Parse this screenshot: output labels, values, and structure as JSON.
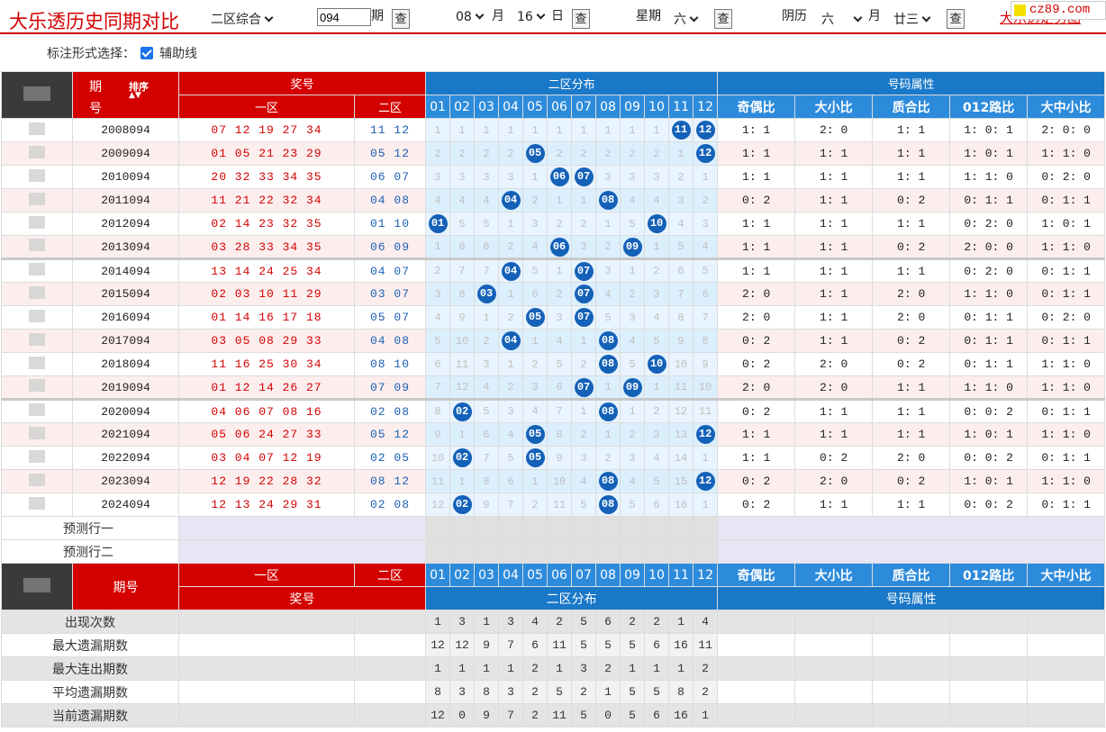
{
  "top": {
    "title": "大乐透历史同期对比",
    "zone_select": "二区综合",
    "issue_value": "094",
    "issue_unit": "期",
    "query": "查",
    "month_value": "08",
    "month_unit": "月",
    "day_value": "16",
    "day_unit": "日",
    "weekday_label": "星期",
    "weekday_value": "六",
    "lunar_label": "阴历",
    "lunar_month": "六",
    "lunar_month_unit": "月",
    "lunar_day": "廿三",
    "link": "大乐透走势图",
    "watermark": "cz89.com"
  },
  "options": {
    "label": "标注形式选择：",
    "checkbox_label": "辅助线",
    "checked": true
  },
  "header": {
    "period_top": "期",
    "period_bottom": "号",
    "sort": "排序",
    "prize": "奖号",
    "zone1": "一区",
    "zone2": "二区",
    "dist": "二区分布",
    "attr": "号码属性",
    "nums": [
      "01",
      "02",
      "03",
      "04",
      "05",
      "06",
      "07",
      "08",
      "09",
      "10",
      "11",
      "12"
    ],
    "attrs": [
      "奇偶比",
      "大小比",
      "质合比",
      "012路比",
      "大中小比"
    ],
    "period_foot": "期号"
  },
  "rows": [
    {
      "issue": "2008094",
      "z1": "07 12 19 27 34",
      "z2": "11 12",
      "hits": [
        11,
        12
      ],
      "miss": [
        1,
        1,
        1,
        1,
        1,
        1,
        1,
        1,
        1,
        1,
        0,
        0
      ],
      "attr": [
        "1:1",
        "2:0",
        "1:1",
        "1:0:1",
        "2:0:0"
      ]
    },
    {
      "issue": "2009094",
      "z1": "01 05 21 23 29",
      "z2": "05 12",
      "hits": [
        5,
        12
      ],
      "miss": [
        2,
        2,
        2,
        2,
        0,
        2,
        2,
        2,
        2,
        2,
        1,
        0
      ],
      "attr": [
        "1:1",
        "1:1",
        "1:1",
        "1:0:1",
        "1:1:0"
      ]
    },
    {
      "issue": "2010094",
      "z1": "20 32 33 34 35",
      "z2": "06 07",
      "hits": [
        6,
        7
      ],
      "miss": [
        3,
        3,
        3,
        3,
        1,
        0,
        0,
        3,
        3,
        3,
        2,
        1
      ],
      "attr": [
        "1:1",
        "1:1",
        "1:1",
        "1:1:0",
        "0:2:0"
      ]
    },
    {
      "issue": "2011094",
      "z1": "11 21 22 32 34",
      "z2": "04 08",
      "hits": [
        4,
        8
      ],
      "miss": [
        4,
        4,
        4,
        0,
        2,
        1,
        1,
        0,
        4,
        4,
        3,
        2
      ],
      "attr": [
        "0:2",
        "1:1",
        "0:2",
        "0:1:1",
        "0:1:1"
      ]
    },
    {
      "issue": "2012094",
      "z1": "02 14 23 32 35",
      "z2": "01 10",
      "hits": [
        1,
        10
      ],
      "miss": [
        0,
        5,
        5,
        1,
        3,
        2,
        2,
        1,
        5,
        0,
        4,
        3
      ],
      "attr": [
        "1:1",
        "1:1",
        "1:1",
        "0:2:0",
        "1:0:1"
      ]
    },
    {
      "issue": "2013094",
      "z1": "03 28 33 34 35",
      "z2": "06 09",
      "hits": [
        6,
        9
      ],
      "miss": [
        1,
        6,
        6,
        2,
        4,
        0,
        3,
        2,
        0,
        1,
        5,
        4
      ],
      "attr": [
        "1:1",
        "1:1",
        "0:2",
        "2:0:0",
        "1:1:0"
      ]
    },
    {
      "issue": "2014094",
      "z1": "13 14 24 25 34",
      "z2": "04 07",
      "hits": [
        4,
        7
      ],
      "miss": [
        2,
        7,
        7,
        0,
        5,
        1,
        0,
        3,
        1,
        2,
        6,
        5
      ],
      "attr": [
        "1:1",
        "1:1",
        "1:1",
        "0:2:0",
        "0:1:1"
      ]
    },
    {
      "issue": "2015094",
      "z1": "02 03 10 11 29",
      "z2": "03 07",
      "hits": [
        3,
        7
      ],
      "miss": [
        3,
        8,
        0,
        1,
        6,
        2,
        0,
        4,
        2,
        3,
        7,
        6
      ],
      "attr": [
        "2:0",
        "1:1",
        "2:0",
        "1:1:0",
        "0:1:1"
      ]
    },
    {
      "issue": "2016094",
      "z1": "01 14 16 17 18",
      "z2": "05 07",
      "hits": [
        5,
        7
      ],
      "miss": [
        4,
        9,
        1,
        2,
        0,
        3,
        0,
        5,
        3,
        4,
        8,
        7
      ],
      "attr": [
        "2:0",
        "1:1",
        "2:0",
        "0:1:1",
        "0:2:0"
      ]
    },
    {
      "issue": "2017094",
      "z1": "03 05 08 29 33",
      "z2": "04 08",
      "hits": [
        4,
        8
      ],
      "miss": [
        5,
        10,
        2,
        0,
        1,
        4,
        1,
        0,
        4,
        5,
        9,
        8
      ],
      "attr": [
        "0:2",
        "1:1",
        "0:2",
        "0:1:1",
        "0:1:1"
      ]
    },
    {
      "issue": "2018094",
      "z1": "11 16 25 30 34",
      "z2": "08 10",
      "hits": [
        8,
        10
      ],
      "miss": [
        6,
        11,
        3,
        1,
        2,
        5,
        2,
        0,
        5,
        0,
        10,
        9
      ],
      "attr": [
        "0:2",
        "2:0",
        "0:2",
        "0:1:1",
        "1:1:0"
      ]
    },
    {
      "issue": "2019094",
      "z1": "01 12 14 26 27",
      "z2": "07 09",
      "hits": [
        7,
        9
      ],
      "miss": [
        7,
        12,
        4,
        2,
        3,
        6,
        0,
        1,
        0,
        1,
        11,
        10
      ],
      "attr": [
        "2:0",
        "2:0",
        "1:1",
        "1:1:0",
        "1:1:0"
      ]
    },
    {
      "issue": "2020094",
      "z1": "04 06 07 08 16",
      "z2": "02 08",
      "hits": [
        2,
        8
      ],
      "miss": [
        8,
        0,
        5,
        3,
        4,
        7,
        1,
        0,
        1,
        2,
        12,
        11
      ],
      "attr": [
        "0:2",
        "1:1",
        "1:1",
        "0:0:2",
        "0:1:1"
      ]
    },
    {
      "issue": "2021094",
      "z1": "05 06 24 27 33",
      "z2": "05 12",
      "hits": [
        5,
        12
      ],
      "miss": [
        9,
        1,
        6,
        4,
        0,
        8,
        2,
        1,
        2,
        3,
        13,
        0
      ],
      "attr": [
        "1:1",
        "1:1",
        "1:1",
        "1:0:1",
        "1:1:0"
      ]
    },
    {
      "issue": "2022094",
      "z1": "03 04 07 12 19",
      "z2": "02 05",
      "hits": [
        2,
        5
      ],
      "miss": [
        10,
        0,
        7,
        5,
        0,
        9,
        3,
        2,
        3,
        4,
        14,
        1
      ],
      "attr": [
        "1:1",
        "0:2",
        "2:0",
        "0:0:2",
        "0:1:1"
      ]
    },
    {
      "issue": "2023094",
      "z1": "12 19 22 28 32",
      "z2": "08 12",
      "hits": [
        8,
        12
      ],
      "miss": [
        11,
        1,
        8,
        6,
        1,
        10,
        4,
        0,
        4,
        5,
        15,
        0
      ],
      "attr": [
        "0:2",
        "2:0",
        "0:2",
        "1:0:1",
        "1:1:0"
      ]
    },
    {
      "issue": "2024094",
      "z1": "12 13 24 29 31",
      "z2": "02 08",
      "hits": [
        2,
        8
      ],
      "miss": [
        12,
        0,
        9,
        7,
        2,
        11,
        5,
        0,
        5,
        6,
        16,
        1
      ],
      "attr": [
        "0:2",
        "1:1",
        "1:1",
        "0:0:2",
        "0:1:1"
      ]
    }
  ],
  "pred": [
    "预测行一",
    "预测行二"
  ],
  "stats": [
    {
      "label": "出现次数",
      "vals": [
        1,
        3,
        1,
        3,
        4,
        2,
        5,
        6,
        2,
        2,
        1,
        4
      ]
    },
    {
      "label": "最大遗漏期数",
      "vals": [
        12,
        12,
        9,
        7,
        6,
        11,
        5,
        5,
        5,
        6,
        16,
        11
      ]
    },
    {
      "label": "最大连出期数",
      "vals": [
        1,
        1,
        1,
        1,
        2,
        1,
        3,
        2,
        1,
        1,
        1,
        2
      ]
    },
    {
      "label": "平均遗漏期数",
      "vals": [
        8,
        3,
        8,
        3,
        2,
        5,
        2,
        1,
        5,
        5,
        8,
        2
      ]
    },
    {
      "label": "当前遗漏期数",
      "vals": [
        12,
        0,
        9,
        7,
        2,
        11,
        5,
        0,
        5,
        6,
        16,
        1
      ]
    }
  ]
}
